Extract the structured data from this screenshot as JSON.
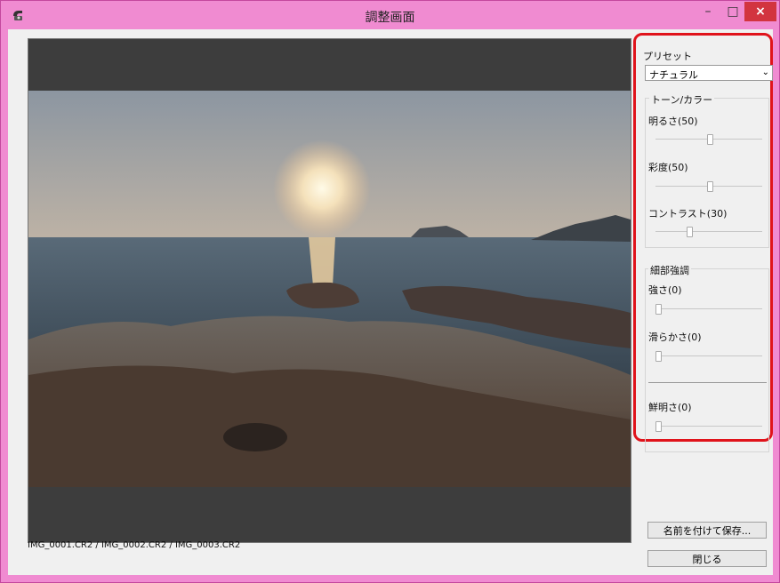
{
  "window": {
    "title": "調整画面",
    "icon": "app-icon"
  },
  "photo": {
    "description": "sunset seascape with rocks in foreground"
  },
  "file_list": "IMG_0001.CR2 / IMG_0002.CR2 / IMG_0003.CR2",
  "preset": {
    "label": "プリセット",
    "selected": "ナチュラル"
  },
  "tone": {
    "group_label": "トーン/カラー",
    "brightness_label": "明るさ(50)",
    "brightness_value": 50,
    "saturation_label": "彩度(50)",
    "saturation_value": 50,
    "contrast_label": "コントラスト(30)",
    "contrast_value": 30
  },
  "detail": {
    "group_label": "細部強調",
    "strength_label": "強さ(0)",
    "strength_value": 0,
    "smoothness_label": "滑らかさ(0)",
    "smoothness_value": 0,
    "clarity_label": "鮮明さ(0)",
    "clarity_value": 0
  },
  "buttons": {
    "save_as": "名前を付けて保存...",
    "close": "閉じる"
  },
  "colors": {
    "title_bar": "#f08bd1",
    "highlight": "#e0131b",
    "close_button": "#d2343f"
  }
}
